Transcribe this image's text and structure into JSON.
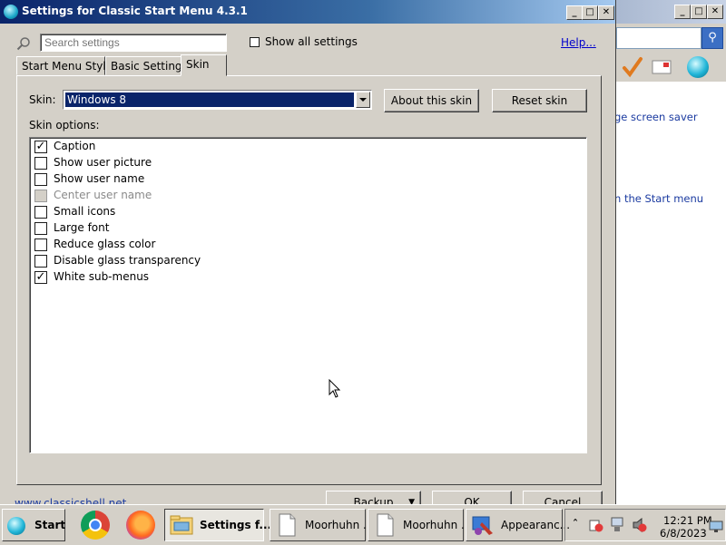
{
  "window": {
    "title": "Settings for Classic Start Menu 4.3.1"
  },
  "search": {
    "placeholder": "Search settings"
  },
  "show_all": {
    "label": "Show all settings",
    "checked": false
  },
  "help": {
    "label": "Help..."
  },
  "tabs": [
    {
      "label": "Start Menu Style",
      "active": false
    },
    {
      "label": "Basic Settings",
      "active": false
    },
    {
      "label": "Skin",
      "active": true
    }
  ],
  "skin": {
    "label": "Skin:",
    "selected": "Windows 8",
    "about_button": "About this skin",
    "reset_button": "Reset skin",
    "options_label": "Skin options:"
  },
  "options": [
    {
      "label": "Caption",
      "checked": true,
      "enabled": true
    },
    {
      "label": "Show user picture",
      "checked": false,
      "enabled": true
    },
    {
      "label": "Show user name",
      "checked": false,
      "enabled": true
    },
    {
      "label": "Center user name",
      "checked": false,
      "enabled": false
    },
    {
      "label": "Small icons",
      "checked": false,
      "enabled": true
    },
    {
      "label": "Large font",
      "checked": false,
      "enabled": true
    },
    {
      "label": "Reduce glass color",
      "checked": false,
      "enabled": true
    },
    {
      "label": "Disable glass transparency",
      "checked": false,
      "enabled": true
    },
    {
      "label": "White sub-menus",
      "checked": true,
      "enabled": true
    }
  ],
  "footer": {
    "link": "www.classicshell.net",
    "backup_button": "Backup",
    "ok_button": "OK",
    "cancel_button": "Cancel"
  },
  "bg_window": {
    "link1": "ge screen saver",
    "link2": "n the Start menu"
  },
  "taskbar": {
    "start_label": "Start",
    "tasks": [
      {
        "label": "Settings f...",
        "icon": "settings-folder-icon",
        "active": true
      },
      {
        "label": "Moorhuhn ...",
        "icon": "document-icon",
        "active": false
      },
      {
        "label": "Moorhuhn ...",
        "icon": "document-icon",
        "active": false
      },
      {
        "label": "Appearanc...",
        "icon": "appearance-icon",
        "active": false
      }
    ],
    "clock_time": "12:21 PM",
    "clock_date": "6/8/2023"
  }
}
